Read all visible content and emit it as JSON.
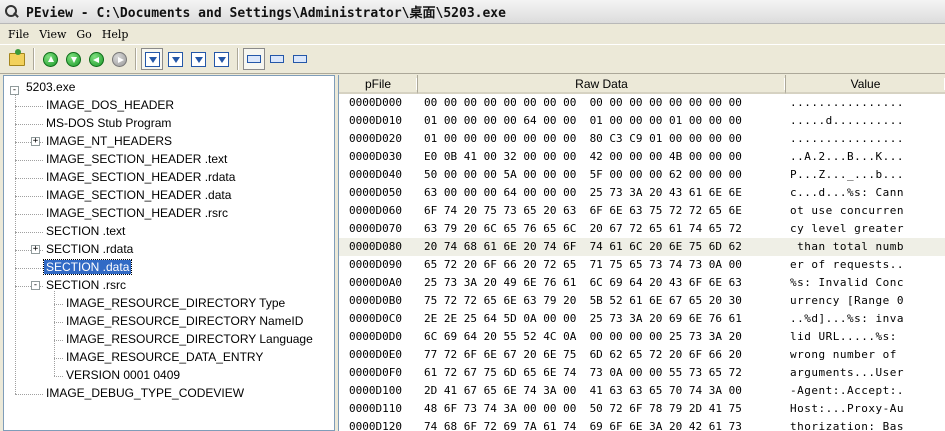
{
  "window": {
    "title": "PEview - C:\\Documents and Settings\\Administrator\\桌面\\5203.exe"
  },
  "menu": [
    "File",
    "View",
    "Go",
    "Help"
  ],
  "toolbar": {
    "icons": [
      "open-file-icon",
      "up-arrow-icon",
      "down-arrow-icon",
      "back-arrow-icon",
      "forward-arrow-icon",
      "save-view-icon",
      "mail-icon",
      "export-icon",
      "import-icon",
      "view-byte-icon",
      "view-word-icon",
      "view-dword-icon"
    ]
  },
  "tree": {
    "root": "5203.exe",
    "items": [
      {
        "label": "IMAGE_DOS_HEADER",
        "level": 1,
        "expander": ""
      },
      {
        "label": "MS-DOS Stub Program",
        "level": 1,
        "expander": ""
      },
      {
        "label": "IMAGE_NT_HEADERS",
        "level": 1,
        "expander": "+"
      },
      {
        "label": "IMAGE_SECTION_HEADER .text",
        "level": 1,
        "expander": ""
      },
      {
        "label": "IMAGE_SECTION_HEADER .rdata",
        "level": 1,
        "expander": ""
      },
      {
        "label": "IMAGE_SECTION_HEADER .data",
        "level": 1,
        "expander": ""
      },
      {
        "label": "IMAGE_SECTION_HEADER .rsrc",
        "level": 1,
        "expander": ""
      },
      {
        "label": "SECTION .text",
        "level": 1,
        "expander": ""
      },
      {
        "label": "SECTION .rdata",
        "level": 1,
        "expander": "+"
      },
      {
        "label": "SECTION .data",
        "level": 1,
        "expander": "",
        "selected": true
      },
      {
        "label": "SECTION .rsrc",
        "level": 1,
        "expander": "-"
      },
      {
        "label": "IMAGE_RESOURCE_DIRECTORY Type",
        "level": 2,
        "expander": ""
      },
      {
        "label": "IMAGE_RESOURCE_DIRECTORY NameID",
        "level": 2,
        "expander": ""
      },
      {
        "label": "IMAGE_RESOURCE_DIRECTORY Language",
        "level": 2,
        "expander": ""
      },
      {
        "label": "IMAGE_RESOURCE_DATA_ENTRY",
        "level": 2,
        "expander": ""
      },
      {
        "label": "VERSION  0001  0409",
        "level": 2,
        "expander": ""
      },
      {
        "label": "IMAGE_DEBUG_TYPE_CODEVIEW",
        "level": 1,
        "expander": ""
      }
    ]
  },
  "columns": [
    "pFile",
    "Raw Data",
    "Value"
  ],
  "rows": [
    {
      "pfile": "0000D000",
      "raw": "00 00 00 00 00 00 00 00  00 00 00 00 00 00 00 00",
      "value": "................"
    },
    {
      "pfile": "0000D010",
      "raw": "01 00 00 00 00 64 00 00  01 00 00 00 01 00 00 00",
      "value": ".....d.........."
    },
    {
      "pfile": "0000D020",
      "raw": "01 00 00 00 00 00 00 00  80 C3 C9 01 00 00 00 00",
      "value": "................"
    },
    {
      "pfile": "0000D030",
      "raw": "E0 0B 41 00 32 00 00 00  42 00 00 00 4B 00 00 00",
      "value": "..A.2...B...K..."
    },
    {
      "pfile": "0000D040",
      "raw": "50 00 00 00 5A 00 00 00  5F 00 00 00 62 00 00 00",
      "value": "P...Z..._...b..."
    },
    {
      "pfile": "0000D050",
      "raw": "63 00 00 00 64 00 00 00  25 73 3A 20 43 61 6E 6E",
      "value": "c...d...%s: Cann"
    },
    {
      "pfile": "0000D060",
      "raw": "6F 74 20 75 73 65 20 63  6F 6E 63 75 72 72 65 6E",
      "value": "ot use concurren"
    },
    {
      "pfile": "0000D070",
      "raw": "63 79 20 6C 65 76 65 6C  20 67 72 65 61 74 65 72",
      "value": "cy level greater"
    },
    {
      "pfile": "0000D080",
      "raw": "20 74 68 61 6E 20 74 6F  74 61 6C 20 6E 75 6D 62",
      "value": " than total numb",
      "highlight": true
    },
    {
      "pfile": "0000D090",
      "raw": "65 72 20 6F 66 20 72 65  71 75 65 73 74 73 0A 00",
      "value": "er of requests.."
    },
    {
      "pfile": "0000D0A0",
      "raw": "25 73 3A 20 49 6E 76 61  6C 69 64 20 43 6F 6E 63",
      "value": "%s: Invalid Conc"
    },
    {
      "pfile": "0000D0B0",
      "raw": "75 72 72 65 6E 63 79 20  5B 52 61 6E 67 65 20 30",
      "value": "urrency [Range 0"
    },
    {
      "pfile": "0000D0C0",
      "raw": "2E 2E 25 64 5D 0A 00 00  25 73 3A 20 69 6E 76 61",
      "value": "..%d]...%s: inva"
    },
    {
      "pfile": "0000D0D0",
      "raw": "6C 69 64 20 55 52 4C 0A  00 00 00 00 25 73 3A 20",
      "value": "lid URL.....%s: "
    },
    {
      "pfile": "0000D0E0",
      "raw": "77 72 6F 6E 67 20 6E 75  6D 62 65 72 20 6F 66 20",
      "value": "wrong number of "
    },
    {
      "pfile": "0000D0F0",
      "raw": "61 72 67 75 6D 65 6E 74  73 0A 00 00 55 73 65 72",
      "value": "arguments...User"
    },
    {
      "pfile": "0000D100",
      "raw": "2D 41 67 65 6E 74 3A 00  41 63 63 65 70 74 3A 00",
      "value": "-Agent:.Accept:."
    },
    {
      "pfile": "0000D110",
      "raw": "48 6F 73 74 3A 00 00 00  50 72 6F 78 79 2D 41 75",
      "value": "Host:...Proxy-Au"
    },
    {
      "pfile": "0000D120",
      "raw": "74 68 6F 72 69 7A 61 74  69 6F 6E 3A 20 42 61 73",
      "value": "thorization: Bas"
    }
  ]
}
